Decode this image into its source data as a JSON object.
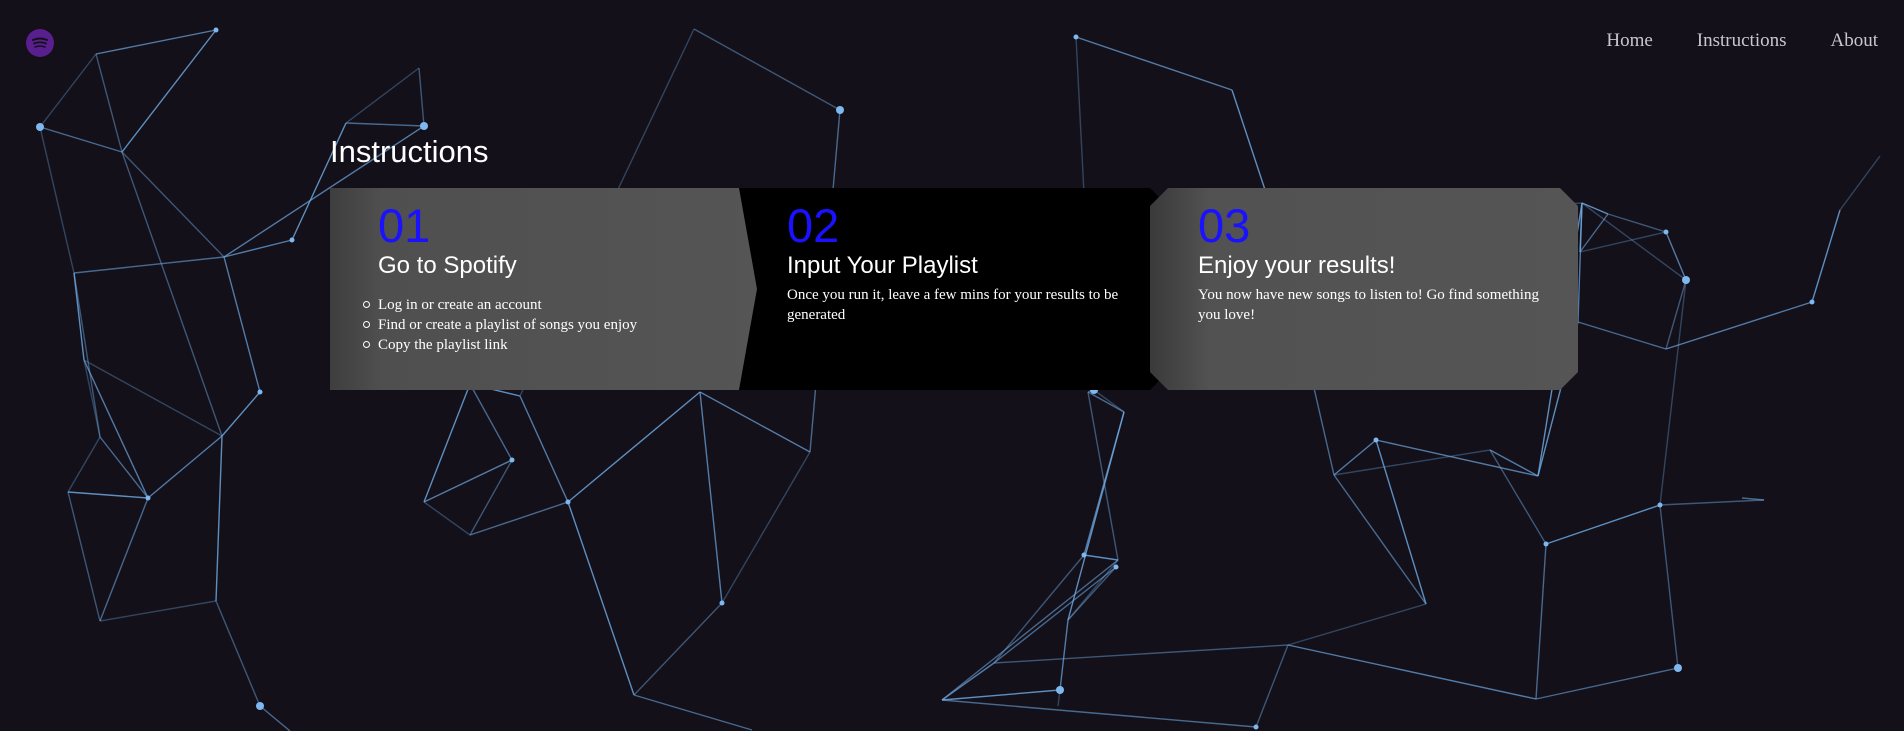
{
  "brand": {
    "icon": "spotify-logo-icon",
    "color": "#5a1f8f"
  },
  "nav": {
    "items": [
      "Home",
      "Instructions",
      "About"
    ]
  },
  "section": {
    "title": "Instructions"
  },
  "cards": [
    {
      "number": "01",
      "title": "Go to Spotify",
      "steps": [
        "Log in or create an account",
        "Find or create a playlist of songs you enjoy",
        "Copy the playlist link"
      ]
    },
    {
      "number": "02",
      "title": "Input Your Playlist",
      "body": "Once you run it, leave a few mins for your results to be generated"
    },
    {
      "number": "03",
      "title": "Enjoy your results!",
      "body": "You now have new songs to listen to! Go find something you love!"
    }
  ],
  "colors": {
    "background": "#13101a",
    "network_line": "#6ea8e0",
    "number_accent": "#1a12ff"
  }
}
